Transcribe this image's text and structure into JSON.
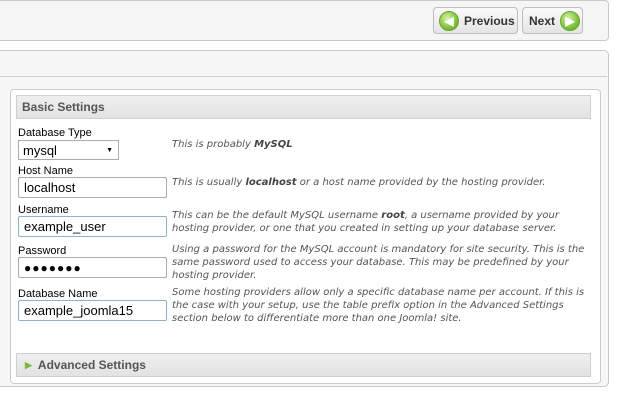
{
  "nav": {
    "previous_label": "Previous",
    "next_label": "Next"
  },
  "basic_settings": {
    "title": "Basic Settings",
    "database_type": {
      "label": "Database Type",
      "value": "mysql",
      "hint_prefix": "This is probably ",
      "hint_bold": "MySQL"
    },
    "host_name": {
      "label": "Host Name",
      "value": "localhost",
      "hint_prefix": "This is usually ",
      "hint_bold": "localhost",
      "hint_suffix": " or a host name provided by the hosting provider."
    },
    "username": {
      "label": "Username",
      "value": "example_user",
      "hint_prefix": "This can be the default MySQL username ",
      "hint_bold": "root",
      "hint_suffix": ", a username provided by your hosting provider, or one that you created in setting up your database server."
    },
    "password": {
      "label": "Password",
      "value": "●●●●●●●",
      "hint": "Using a password for the MySQL account is mandatory for site security. This is the same password used to access your database. This may be predefined by your hosting provider."
    },
    "database_name": {
      "label": "Database Name",
      "value": "example_joomla15",
      "hint": "Some hosting providers allow only a specific database name per account. If this is the case with your setup, use the table prefix option in the Advanced Settings section below to differentiate more than one Joomla! site."
    }
  },
  "advanced_settings": {
    "title": "Advanced Settings"
  },
  "colors": {
    "accent_green": "#7cc23a",
    "bar_text": "#555555"
  }
}
